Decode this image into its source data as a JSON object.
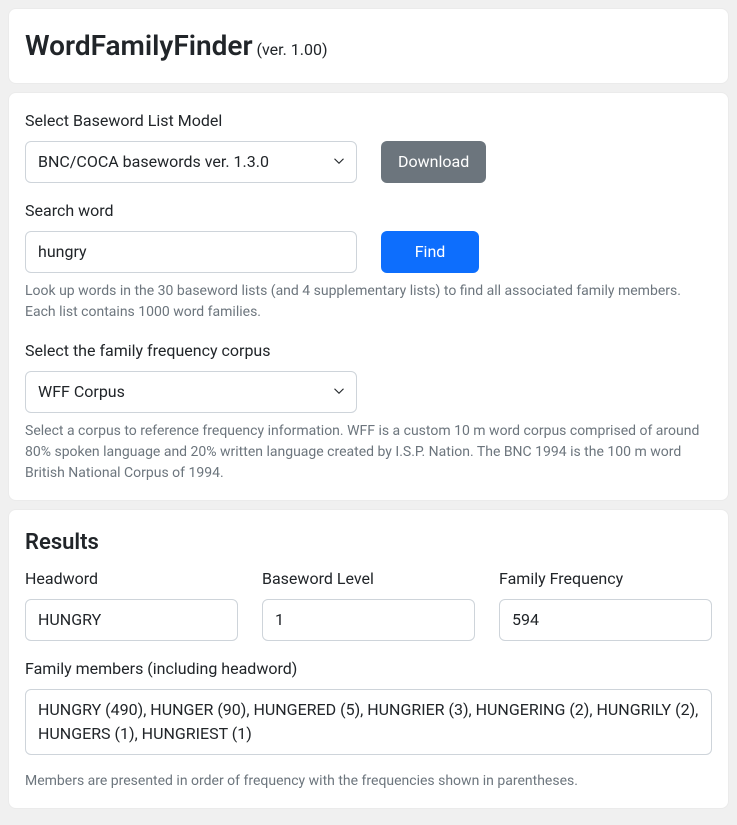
{
  "header": {
    "title": "WordFamilyFinder",
    "version": "(ver. 1.00)"
  },
  "controls": {
    "baseword_label": "Select Baseword List Model",
    "baseword_value": "BNC/COCA basewords ver. 1.3.0",
    "download_label": "Download",
    "search_label": "Search word",
    "search_value": "hungry",
    "find_label": "Find",
    "search_help": "Look up words in the 30 baseword lists (and 4 supplementary lists) to find all associated family members. Each list contains 1000 word families.",
    "corpus_label": "Select the family frequency corpus",
    "corpus_value": "WFF Corpus",
    "corpus_help": "Select a corpus to reference frequency information. WFF is a custom 10 m word corpus comprised of around 80% spoken language and 20% written language created by I.S.P. Nation. The BNC 1994 is the 100 m word British National Corpus of 1994."
  },
  "results": {
    "title": "Results",
    "headword_label": "Headword",
    "headword_value": "HUNGRY",
    "level_label": "Baseword Level",
    "level_value": "1",
    "frequency_label": "Family Frequency",
    "frequency_value": "594",
    "members_label": "Family members (including headword)",
    "members_value": "HUNGRY (490), HUNGER (90), HUNGERED (5), HUNGRIER (3), HUNGERING (2), HUNGRILY (2), HUNGERS (1), HUNGRIEST (1)",
    "members_help": "Members are presented in order of frequency with the frequencies shown in parentheses."
  }
}
